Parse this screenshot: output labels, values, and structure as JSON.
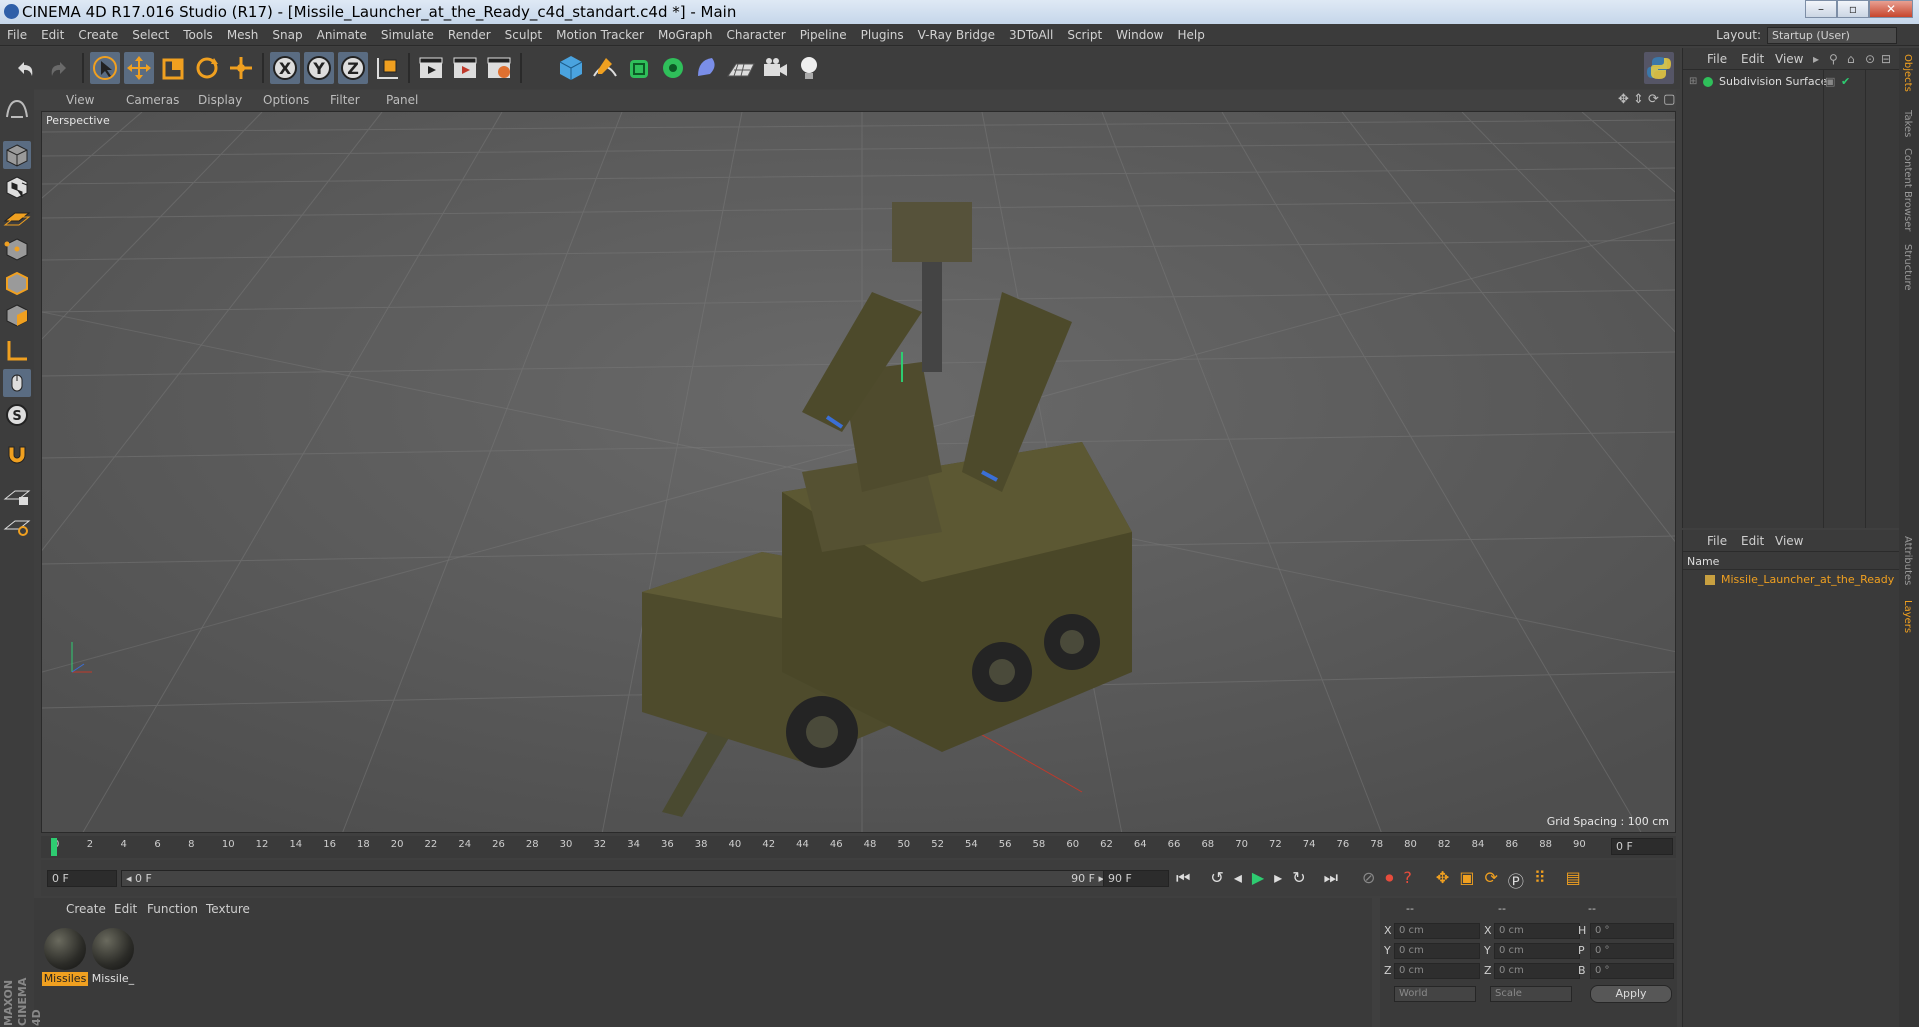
{
  "window": {
    "title": "CINEMA 4D R17.016 Studio (R17) - [Missile_Launcher_at_the_Ready_c4d_standart.c4d *] - Main",
    "controls": [
      "–",
      "▫",
      "✕"
    ]
  },
  "menubar": {
    "items": [
      "File",
      "Edit",
      "Create",
      "Select",
      "Tools",
      "Mesh",
      "Snap",
      "Animate",
      "Simulate",
      "Render",
      "Sculpt",
      "Motion Tracker",
      "MoGraph",
      "Character",
      "Pipeline",
      "Plugins",
      "V-Ray Bridge",
      "3DToAll",
      "Script",
      "Window",
      "Help"
    ],
    "layout_label": "Layout:",
    "layout_value": "Startup (User)"
  },
  "viewport": {
    "menu": [
      "View",
      "Cameras",
      "Display",
      "Options",
      "Filter",
      "Panel"
    ],
    "camera_label": "Perspective",
    "grid_spacing": "Grid Spacing : 100 cm"
  },
  "timeline": {
    "ticks": [
      "0",
      "2",
      "4",
      "6",
      "8",
      "10",
      "12",
      "14",
      "16",
      "18",
      "20",
      "22",
      "24",
      "26",
      "28",
      "30",
      "32",
      "34",
      "36",
      "38",
      "40",
      "42",
      "44",
      "46",
      "48",
      "50",
      "52",
      "54",
      "56",
      "58",
      "60",
      "62",
      "64",
      "66",
      "68",
      "70",
      "72",
      "74",
      "76",
      "78",
      "80",
      "82",
      "84",
      "86",
      "88",
      "90"
    ],
    "current_frame": "0 F",
    "start_field": "0 F",
    "range_start": "◂ 0 F",
    "range_end": "90 F ▸",
    "end_field": "90 F"
  },
  "material_manager": {
    "menu": [
      "Create",
      "Edit",
      "Function",
      "Texture"
    ],
    "materials": [
      {
        "label": "Missiles",
        "selected": true
      },
      {
        "label": "Missile_",
        "selected": false
      }
    ],
    "brand": "MAXON CINEMA 4D"
  },
  "coordinates": {
    "headers": [
      "--",
      "--",
      "--"
    ],
    "rows": [
      {
        "a": "X",
        "av": "0 cm",
        "b": "X",
        "bv": "0 cm",
        "c": "H",
        "cv": "0 °"
      },
      {
        "a": "Y",
        "av": "0 cm",
        "b": "Y",
        "bv": "0 cm",
        "c": "P",
        "cv": "0 °"
      },
      {
        "a": "Z",
        "av": "0 cm",
        "b": "Z",
        "bv": "0 cm",
        "c": "B",
        "cv": "0 °"
      }
    ],
    "world": "World",
    "scale": "Scale",
    "apply": "Apply"
  },
  "object_manager": {
    "menu": [
      "File",
      "Edit",
      "View"
    ],
    "objects": [
      {
        "name": "Subdivision Surface"
      }
    ]
  },
  "layer_panel": {
    "menu": [
      "File",
      "Edit",
      "View"
    ],
    "column": "Name",
    "items": [
      {
        "name": "Missile_Launcher_at_the_Ready",
        "color": "#c8a040"
      }
    ]
  },
  "side_tabs": [
    "Objects",
    "Takes",
    "Content Browser",
    "Structure",
    "Attributes",
    "Layers"
  ],
  "colors": {
    "accent": "#f0a020",
    "viewport_bg": "#5a5a5a",
    "ui_bg": "#3d3d3d"
  }
}
